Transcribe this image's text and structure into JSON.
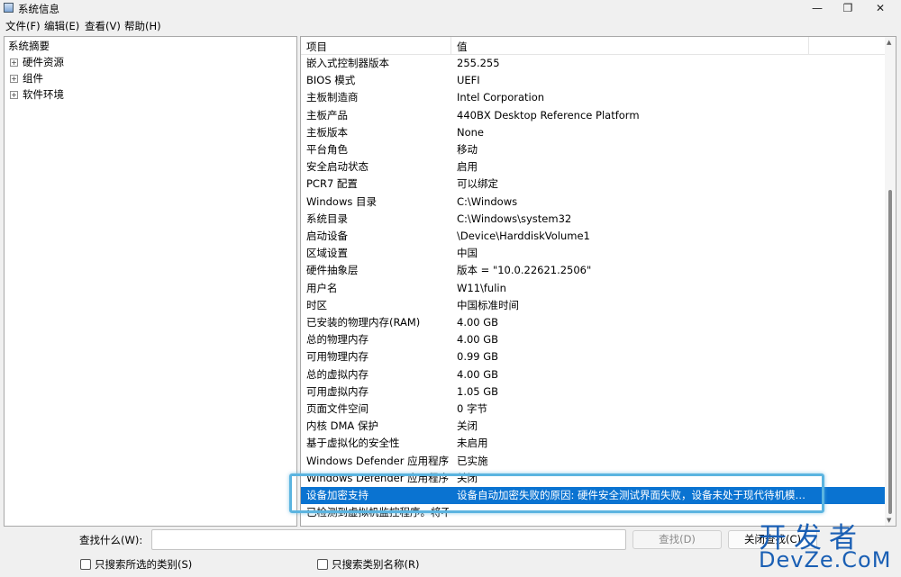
{
  "window": {
    "title": "系统信息",
    "icon": "system-info-icon",
    "controls": {
      "minimize": "—",
      "maximize": "❐",
      "close": "✕"
    }
  },
  "menu": [
    {
      "label": "文件(F)"
    },
    {
      "label": "编辑(E)"
    },
    {
      "label": "查看(V)"
    },
    {
      "label": "帮助(H)"
    }
  ],
  "tree": {
    "root": "系统摘要",
    "children": [
      {
        "label": "硬件资源",
        "expander": "+"
      },
      {
        "label": "组件",
        "expander": "+"
      },
      {
        "label": "软件环境",
        "expander": "+"
      }
    ]
  },
  "list": {
    "columns": {
      "item": "项目",
      "value": "值"
    },
    "rows": [
      {
        "item": "嵌入式控制器版本",
        "value": "255.255"
      },
      {
        "item": "BIOS 模式",
        "value": "UEFI"
      },
      {
        "item": "主板制造商",
        "value": "Intel Corporation"
      },
      {
        "item": "主板产品",
        "value": "440BX Desktop Reference Platform"
      },
      {
        "item": "主板版本",
        "value": "None"
      },
      {
        "item": "平台角色",
        "value": "移动"
      },
      {
        "item": "安全启动状态",
        "value": "启用"
      },
      {
        "item": "PCR7 配置",
        "value": "可以绑定"
      },
      {
        "item": "Windows 目录",
        "value": "C:\\Windows"
      },
      {
        "item": "系统目录",
        "value": "C:\\Windows\\system32"
      },
      {
        "item": "启动设备",
        "value": "\\Device\\HarddiskVolume1"
      },
      {
        "item": "区域设置",
        "value": "中国"
      },
      {
        "item": "硬件抽象层",
        "value": "版本 = \"10.0.22621.2506\""
      },
      {
        "item": "用户名",
        "value": "W11\\fulin"
      },
      {
        "item": "时区",
        "value": "中国标准时间"
      },
      {
        "item": "已安装的物理内存(RAM)",
        "value": "4.00 GB"
      },
      {
        "item": "总的物理内存",
        "value": "4.00 GB"
      },
      {
        "item": "可用物理内存",
        "value": "0.99 GB"
      },
      {
        "item": "总的虚拟内存",
        "value": "4.00 GB"
      },
      {
        "item": "可用虚拟内存",
        "value": "1.05 GB"
      },
      {
        "item": "页面文件空间",
        "value": "0 字节"
      },
      {
        "item": "内核 DMA 保护",
        "value": "关闭"
      },
      {
        "item": "基于虚拟化的安全性",
        "value": "未启用"
      },
      {
        "item": "Windows Defender 应用程序...",
        "value": "已实施"
      },
      {
        "item": "Windows Defender 应用程序...",
        "value": "关闭"
      },
      {
        "item": "设备加密支持",
        "value": "设备自动加密失败的原因: 硬件安全测试界面失败，设备未处于现代待机模式, ...",
        "selected": true
      },
      {
        "item": "已检测到虚拟机监控程序。将不...",
        "value": ""
      }
    ]
  },
  "find": {
    "label": "查找什么(W):",
    "value": "",
    "find_button": "查找(D)",
    "close_button": "关闭查找(C)",
    "opt_selected": "只搜索所选的类别(S)",
    "opt_names": "只搜索类别名称(R)"
  },
  "watermark": {
    "line1": "开发者",
    "line2": "DevZe.CoM"
  },
  "colors": {
    "selection": "#0a73d1",
    "highlight_box": "#5bb4e0",
    "watermark": "#1a5fb4"
  }
}
